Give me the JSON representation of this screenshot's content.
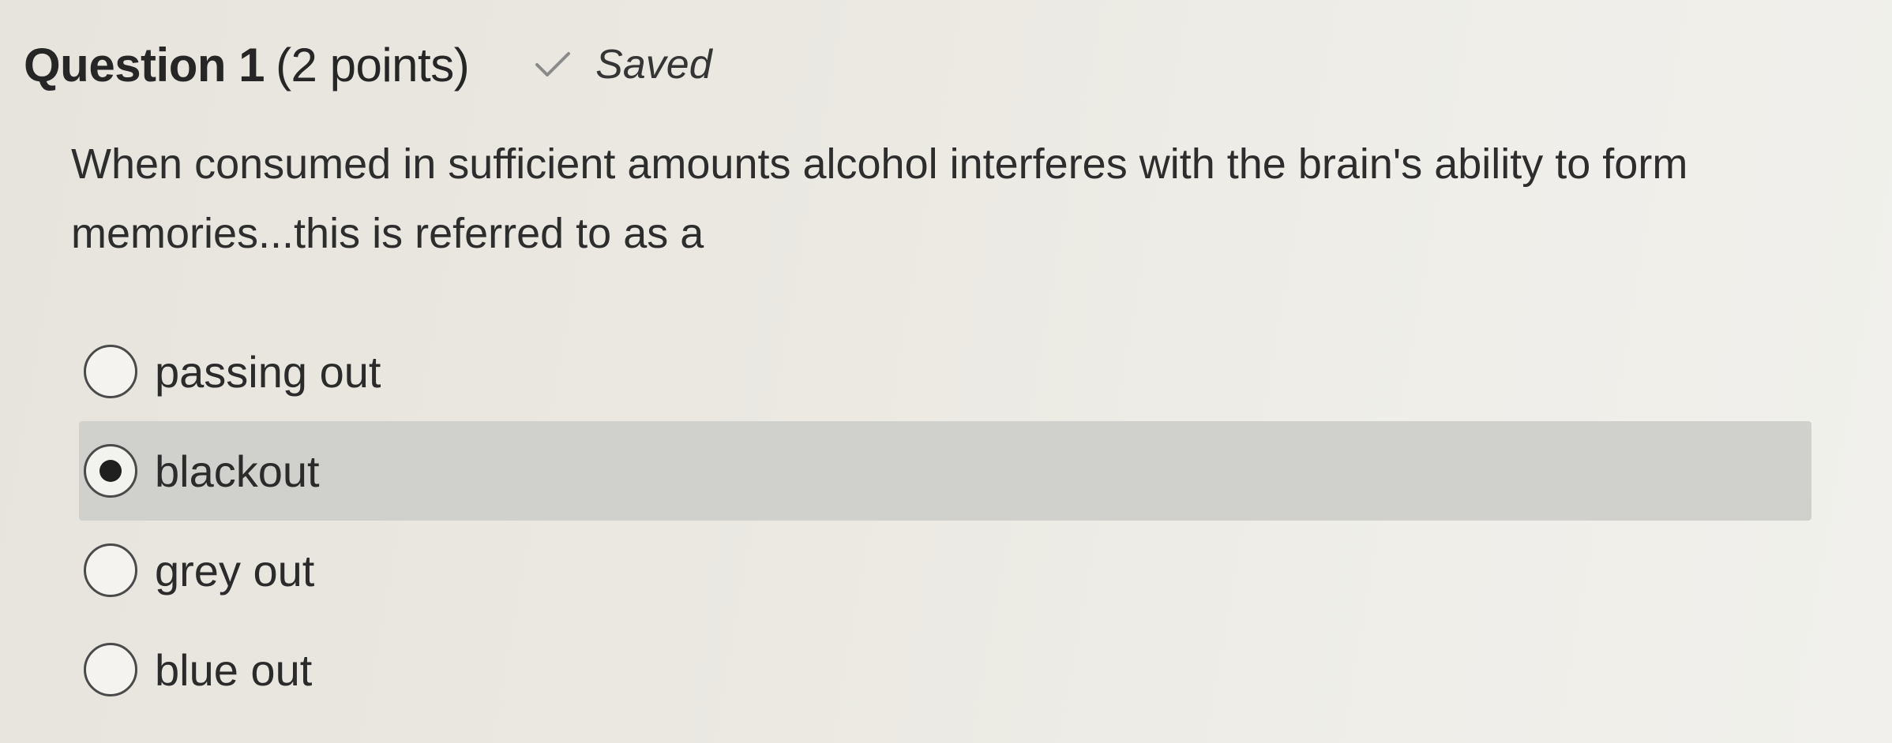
{
  "question": {
    "title": "Question 1",
    "points": "(2 points)",
    "status": "Saved",
    "status_icon": "check-icon",
    "prompt": "When consumed in sufficient amounts alcohol interferes with the brain's ability to form memories...this is referred to as a"
  },
  "options": [
    {
      "label": "passing out",
      "selected": false
    },
    {
      "label": "blackout",
      "selected": true
    },
    {
      "label": "grey out",
      "selected": false
    },
    {
      "label": "blue out",
      "selected": false
    }
  ],
  "colors": {
    "background": "#ebe9e2",
    "selected_row": "#d0d1cd",
    "text": "#2d2d2d",
    "check": "#8a8a8a"
  }
}
